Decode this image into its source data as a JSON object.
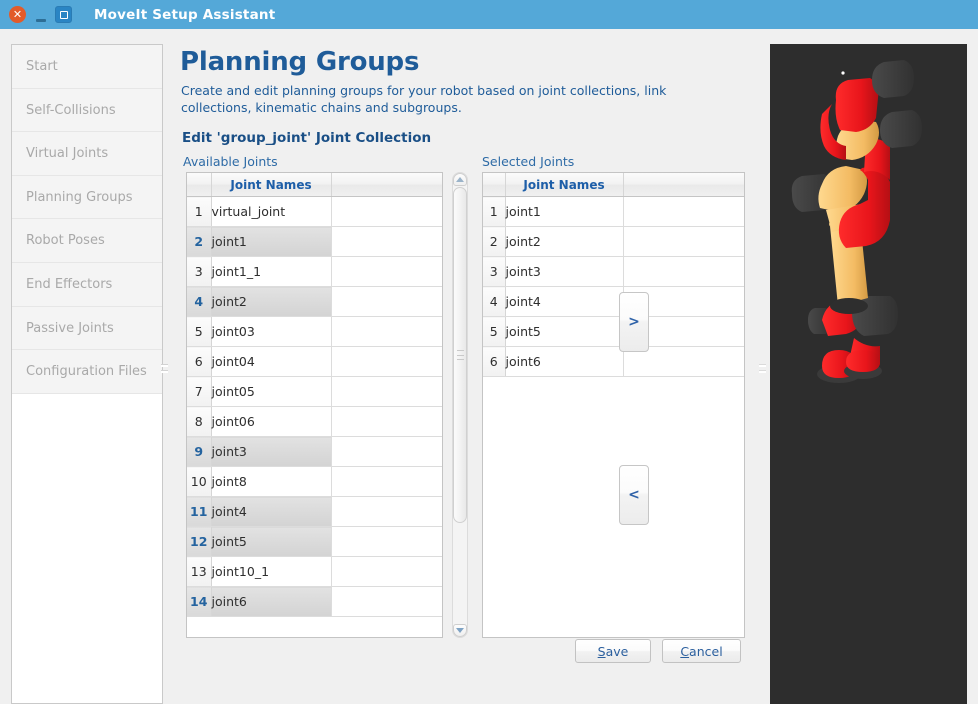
{
  "window": {
    "title": "MoveIt Setup Assistant",
    "controls": {
      "close": "close-icon",
      "minimize": "minimize-icon",
      "maximize": "maximize-icon"
    },
    "titlebar_color": "#54a8d8"
  },
  "sidebar": {
    "items": [
      {
        "label": "Start"
      },
      {
        "label": "Self-Collisions"
      },
      {
        "label": "Virtual Joints"
      },
      {
        "label": "Planning Groups"
      },
      {
        "label": "Robot Poses"
      },
      {
        "label": "End Effectors"
      },
      {
        "label": "Passive Joints"
      },
      {
        "label": "Configuration Files"
      }
    ]
  },
  "main": {
    "page_title": "Planning Groups",
    "page_description": "Create and edit planning groups for your robot based on joint collections, link collections, kinematic chains and subgroups.",
    "section_title": "Edit 'group_joint' Joint Collection",
    "available_label": "Available Joints",
    "selected_label": "Selected Joints",
    "column_header": "Joint Names",
    "available_joints": [
      {
        "index": "1",
        "name": "virtual_joint",
        "selected": false
      },
      {
        "index": "2",
        "name": "joint1",
        "selected": true
      },
      {
        "index": "3",
        "name": "joint1_1",
        "selected": false
      },
      {
        "index": "4",
        "name": "joint2",
        "selected": true
      },
      {
        "index": "5",
        "name": "joint03",
        "selected": false
      },
      {
        "index": "6",
        "name": "joint04",
        "selected": false
      },
      {
        "index": "7",
        "name": "joint05",
        "selected": false
      },
      {
        "index": "8",
        "name": "joint06",
        "selected": false
      },
      {
        "index": "9",
        "name": "joint3",
        "selected": true
      },
      {
        "index": "10",
        "name": "joint8",
        "selected": false
      },
      {
        "index": "11",
        "name": "joint4",
        "selected": true
      },
      {
        "index": "12",
        "name": "joint5",
        "selected": true
      },
      {
        "index": "13",
        "name": "joint10_1",
        "selected": false
      },
      {
        "index": "14",
        "name": "joint6",
        "selected": true
      }
    ],
    "selected_joints": [
      {
        "index": "1",
        "name": "joint1"
      },
      {
        "index": "2",
        "name": "joint2"
      },
      {
        "index": "3",
        "name": "joint3"
      },
      {
        "index": "4",
        "name": "joint4"
      },
      {
        "index": "5",
        "name": "joint5"
      },
      {
        "index": "6",
        "name": "joint6"
      }
    ],
    "move_right_label": ">",
    "move_left_label": "<",
    "save_label": "Save",
    "save_mnemonic": "S",
    "save_rest": "ave",
    "cancel_label": "Cancel",
    "cancel_mnemonic": "C",
    "cancel_rest": "ancel"
  },
  "viewport": {
    "background_color": "#2d2d2d",
    "robot_colors": {
      "primary": "#e8151b",
      "secondary": "#f6c36a",
      "joint": "#3b3b3b"
    }
  }
}
